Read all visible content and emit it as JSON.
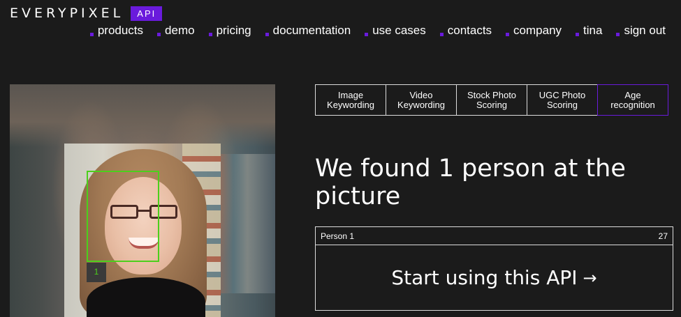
{
  "header": {
    "logo_text": "EVERYPIXEL",
    "logo_badge": "API",
    "accent_color": "#6a1bdc"
  },
  "nav": {
    "items": [
      {
        "label": "products"
      },
      {
        "label": "demo"
      },
      {
        "label": "pricing"
      },
      {
        "label": "documentation"
      },
      {
        "label": "use cases"
      },
      {
        "label": "contacts"
      },
      {
        "label": "company"
      },
      {
        "label": "tina"
      },
      {
        "label": "sign out"
      }
    ]
  },
  "photo": {
    "face_box_color": "#4ccf1c",
    "face_label": "1"
  },
  "tabs": [
    {
      "label": "Image\nKeywording",
      "active": false
    },
    {
      "label": "Video\nKeywording",
      "active": false
    },
    {
      "label": "Stock Photo\nScoring",
      "active": false
    },
    {
      "label": "UGC Photo\nScoring",
      "active": false
    },
    {
      "label": "Age\nrecognition",
      "active": true
    }
  ],
  "result": {
    "headline": "We found 1 person at the picture",
    "person_label": "Person 1",
    "person_age": "27"
  },
  "cta": {
    "label": "Start using this API",
    "arrow_icon": "arrow-right-icon"
  }
}
